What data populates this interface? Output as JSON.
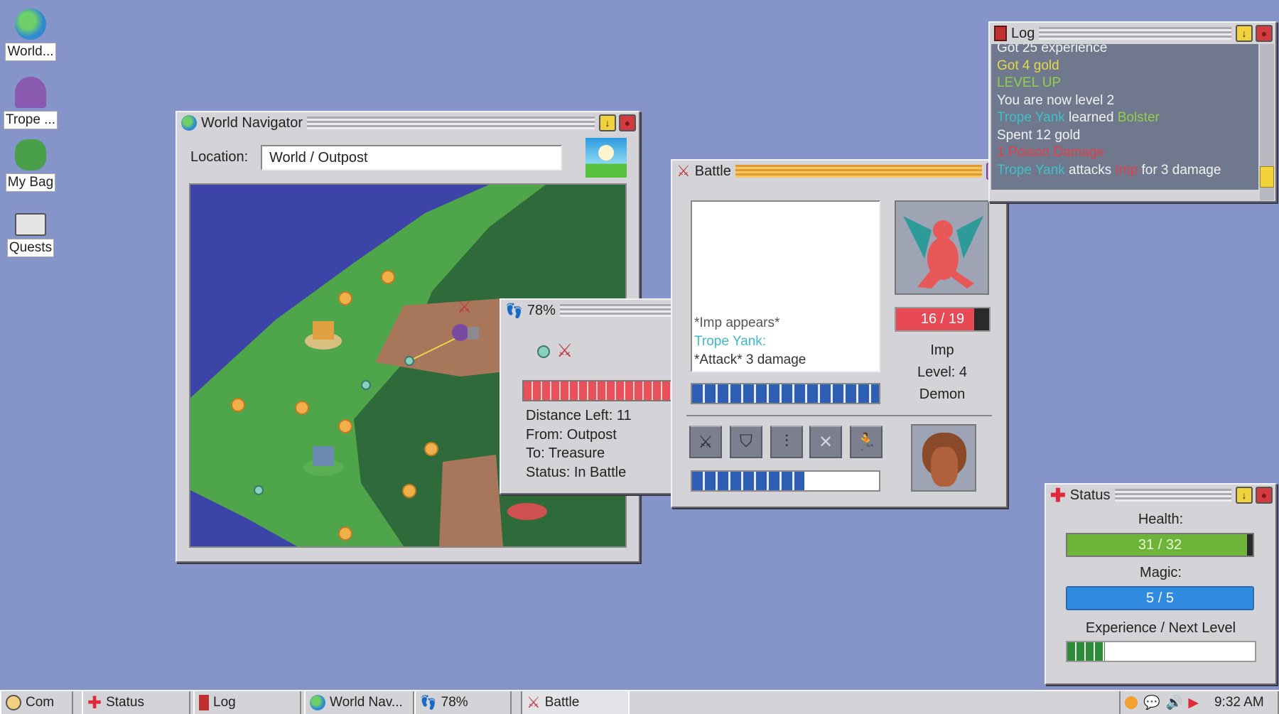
{
  "desktop": {
    "icons": [
      {
        "label": "World...",
        "icon": "globe-icon"
      },
      {
        "label": "Trope ...",
        "icon": "hooded-character-icon"
      },
      {
        "label": "My Bag",
        "icon": "bag-icon"
      },
      {
        "label": "Quests",
        "icon": "envelope-icon"
      }
    ]
  },
  "world_navigator": {
    "title": "World Navigator",
    "location_label": "Location:",
    "location_value": "World / Outpost",
    "weather": "sunny-icon"
  },
  "travel": {
    "title": "78%",
    "progress_percent": 78,
    "distance_left": "Distance Left:  11",
    "from": "From:  Outpost",
    "to": "To:  Treasure",
    "status": "Status:  In Battle"
  },
  "battle": {
    "title": "Battle",
    "log": [
      {
        "text": "*Imp appears*",
        "color": "#555555"
      },
      {
        "text": "Trope Yank:",
        "color": "#3fb8c8"
      },
      {
        "text": "*Attack* 3 damage",
        "color": "#333333"
      }
    ],
    "enemy": {
      "name": "Imp",
      "level": "Level: 4",
      "type": "Demon",
      "hp": "16 / 19",
      "hp_fraction": 0.84
    },
    "enemy_timer_fraction": 1.0,
    "player_timer_fraction": 0.6,
    "actions": [
      "attack",
      "defend",
      "skills",
      "cancel",
      "flee"
    ]
  },
  "log": {
    "title": "Log",
    "lines": [
      [
        {
          "t": "Got 25 experience",
          "c": "#f2f2f2"
        }
      ],
      [
        {
          "t": "Got 4 gold",
          "c": "#e6d84a"
        }
      ],
      [
        {
          "t": "LEVEL UP",
          "c": "#8fd04a"
        }
      ],
      [
        {
          "t": "You are now level 2",
          "c": "#f2f2f2"
        }
      ],
      [
        {
          "t": "Trope Yank",
          "c": "#3fc0c8"
        },
        {
          "t": " learned ",
          "c": "#f2f2f2"
        },
        {
          "t": "Bolster",
          "c": "#8fd04a"
        }
      ],
      [
        {
          "t": "Spent 12 gold",
          "c": "#f2f2f2"
        }
      ],
      [
        {
          "t": "1 Poison Damage",
          "c": "#e0404a"
        }
      ],
      [
        {
          "t": "Trope Yank",
          "c": "#3fc0c8"
        },
        {
          "t": " attacks ",
          "c": "#f2f2f2"
        },
        {
          "t": "Imp",
          "c": "#e0404a"
        },
        {
          "t": " for 3 damage",
          "c": "#f2f2f2"
        }
      ]
    ]
  },
  "status": {
    "title": "Status",
    "health_label": "Health:",
    "health": "31 / 32",
    "health_fraction": 0.97,
    "magic_label": "Magic:",
    "magic": "5 / 5",
    "magic_fraction": 1.0,
    "exp_label": "Experience / Next Level",
    "exp_fraction": 0.2
  },
  "taskbar": {
    "items": [
      "Com",
      "Status",
      "Log",
      "World Nav...",
      "78%",
      "Battle"
    ],
    "active": "Battle",
    "clock": "9:32 AM"
  },
  "colors": {
    "desktop": "#8595c9",
    "battle_title": "#f3b54a",
    "log_bg": "#6f788c",
    "health": "#6fb43a",
    "magic": "#2f8ae0",
    "enemy_hp": "#e84a55"
  }
}
